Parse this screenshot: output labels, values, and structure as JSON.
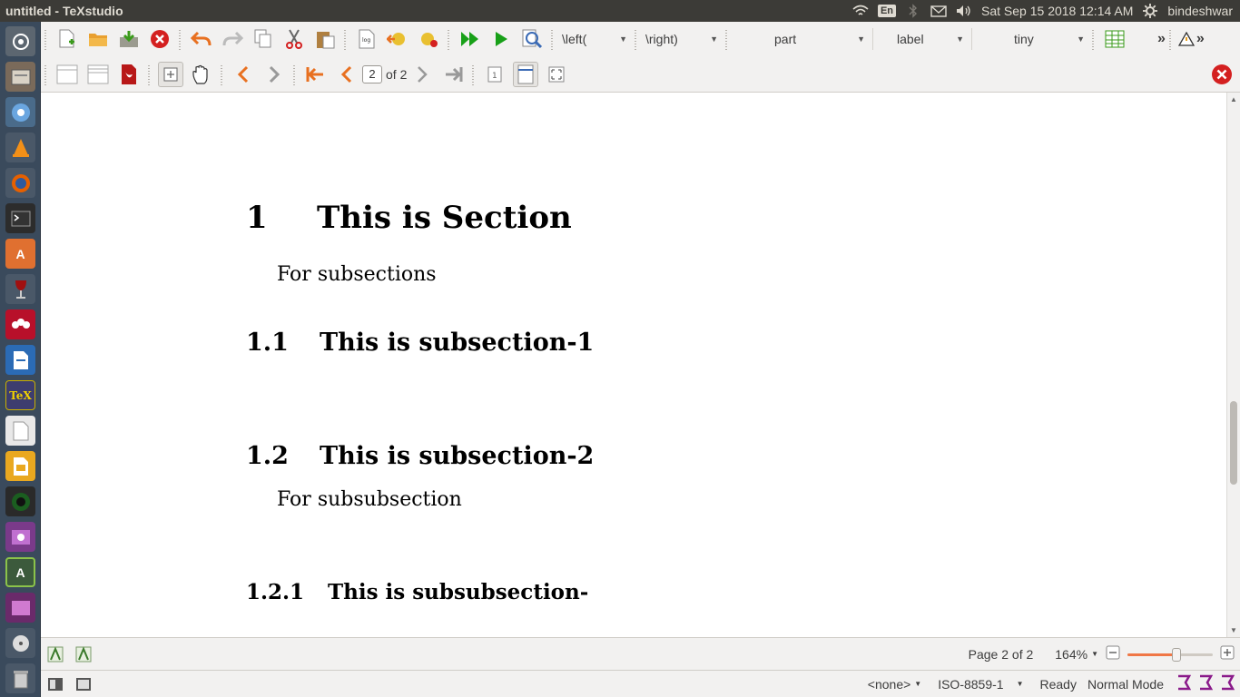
{
  "system": {
    "window_title": "untitled - TeXstudio",
    "lang": "En",
    "datetime": "Sat Sep 15 2018 12:14 AM",
    "user": "bindeshwar"
  },
  "launcher": {
    "items": [
      "dash-icon",
      "files-icon",
      "chromium-icon",
      "vlc-icon",
      "firefox-icon",
      "terminal-icon",
      "software-center-icon",
      "wine-icon",
      "mendeley-icon",
      "writer-icon",
      "texstudio-icon",
      "text-editor-icon",
      "impress-icon",
      "camera-icon",
      "screenshot-icon",
      "updater-icon",
      "workspace-icon",
      "dvd-icon",
      "trash-icon"
    ]
  },
  "toolbar1": {
    "left_combo": "\\left(",
    "right_combo": "\\right)",
    "structure_combo": "part",
    "label_combo": "label",
    "size_combo": "tiny",
    "overflow": "»"
  },
  "toolbar2": {
    "page_value": "2",
    "page_total": "of 2"
  },
  "document": {
    "section_num": "1",
    "section_title": "This is Section",
    "section_body": "For subsections",
    "sub1_num": "1.1",
    "sub1_title": "This is subsection-1",
    "sub2_num": "1.2",
    "sub2_title": "This is subsection-2",
    "sub2_body": "For subsubsection",
    "subsub_num": "1.2.1",
    "subsub_title": "This is subsubsection-"
  },
  "status": {
    "page": "Page 2 of 2",
    "zoom": "164%",
    "zoom_fraction": 0.58,
    "encoding_none": "<none>",
    "encoding": "ISO-8859-1",
    "state": "Ready",
    "mode": "Normal Mode"
  },
  "colors": {
    "panel": "#3c3b37",
    "launcher": "#3a4a5c",
    "accent_orange": "#f07746",
    "run_green": "#18a018",
    "close_red": "#d42020"
  }
}
